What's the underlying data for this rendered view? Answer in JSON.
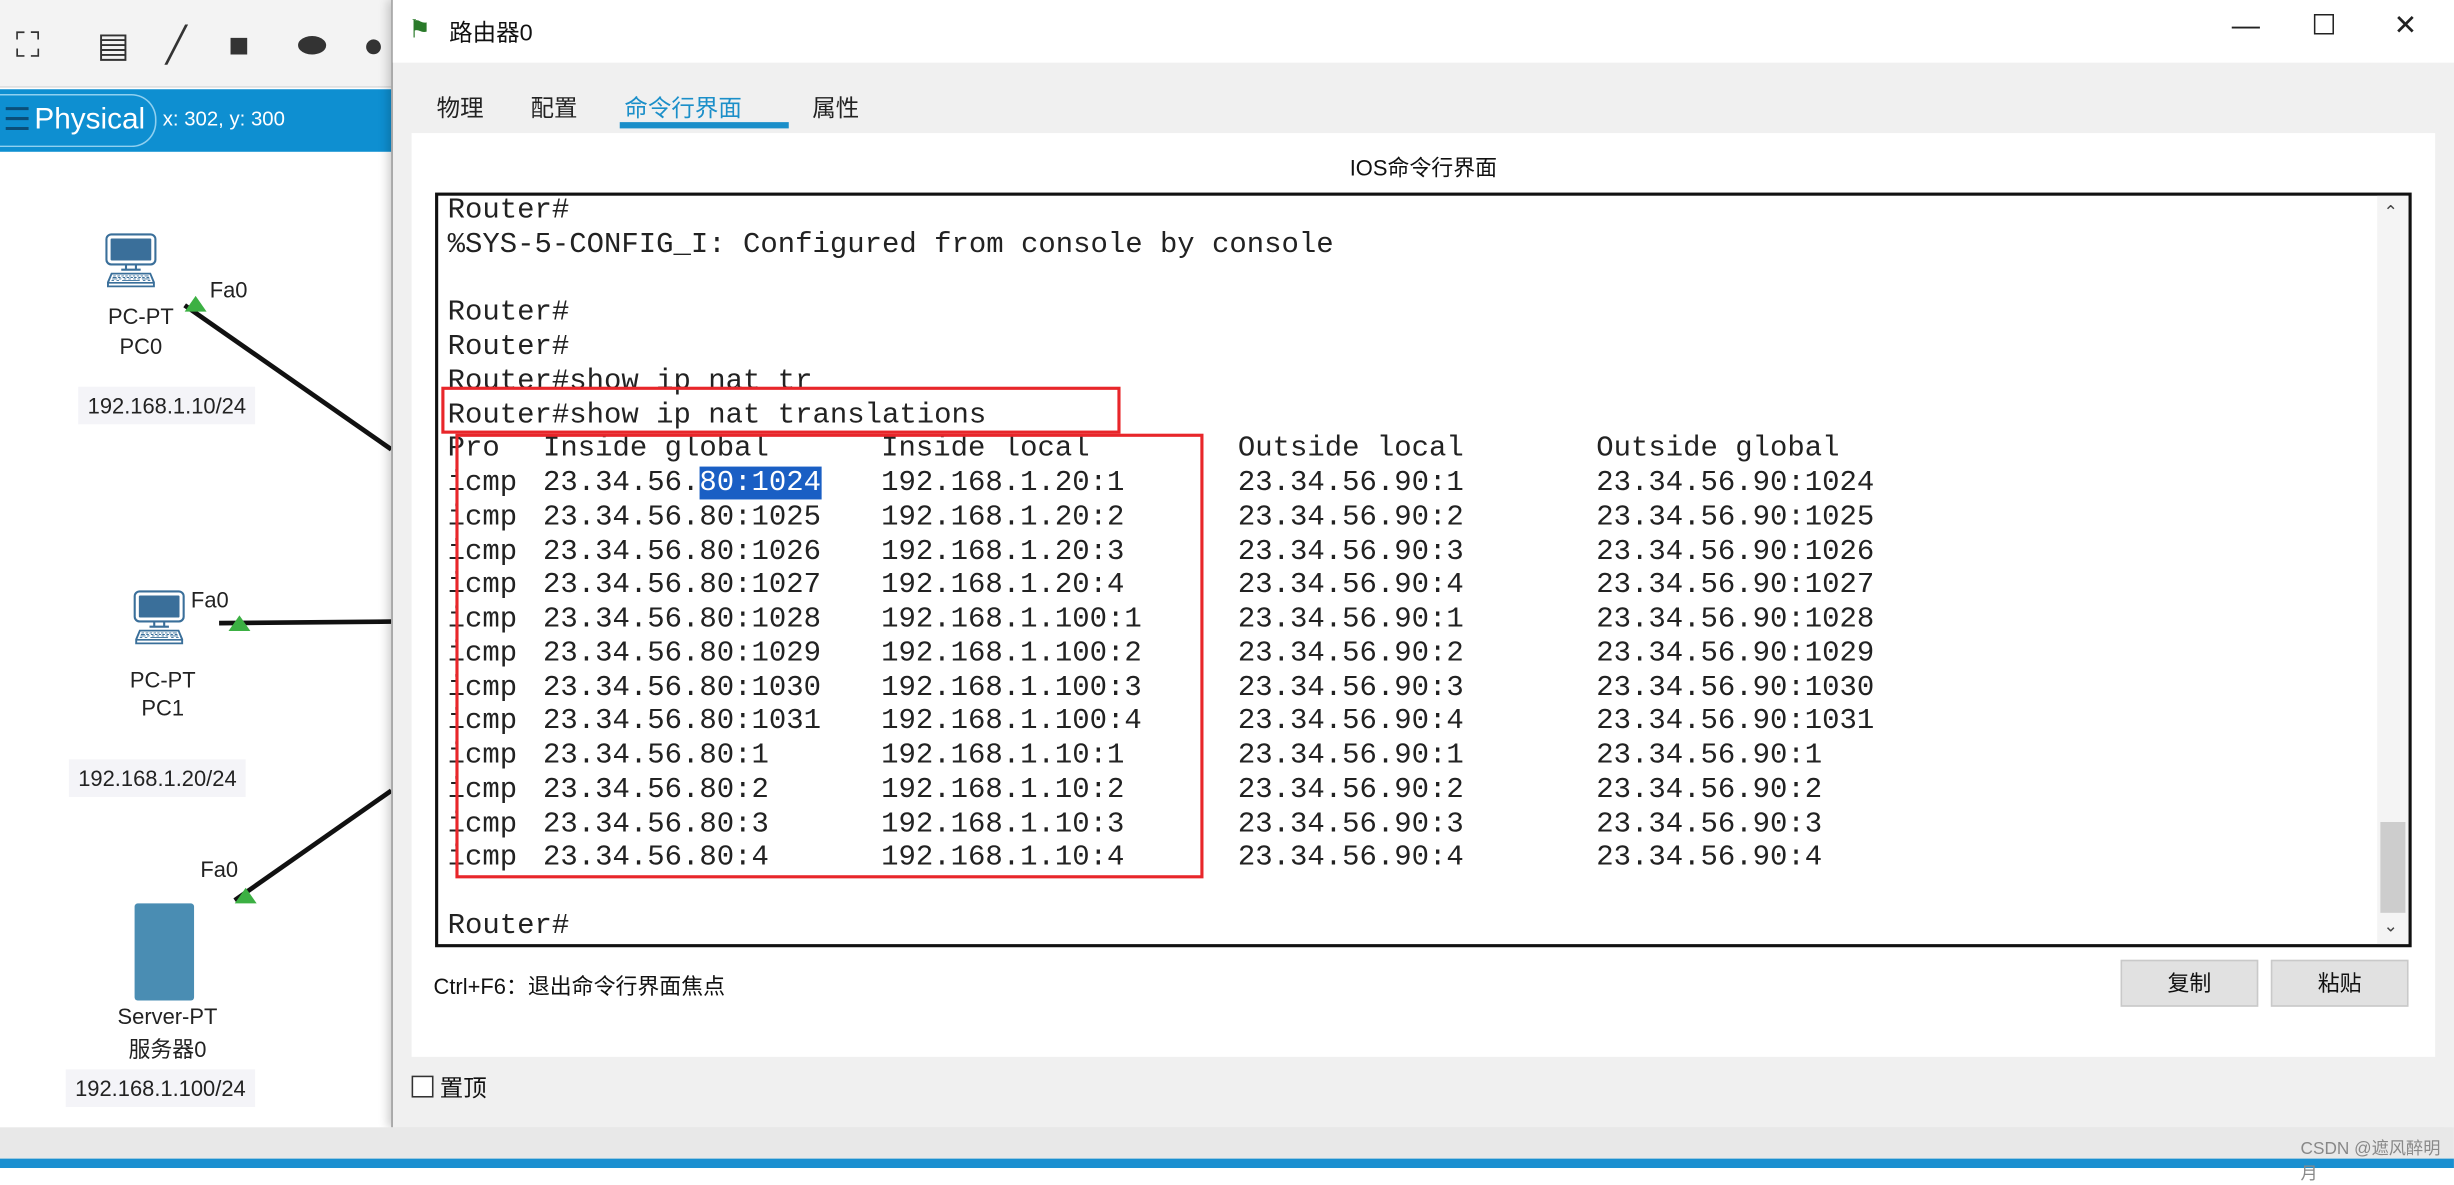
{
  "workspace": {
    "mode_label": "Physical",
    "coords": "x: 302, y: 300",
    "devices": [
      {
        "type": "PC-PT",
        "name": "PC0",
        "port": "Fa0",
        "ip": "192.168.1.10/24"
      },
      {
        "type": "PC-PT",
        "name": "PC1",
        "port": "Fa0",
        "ip": "192.168.1.20/24"
      },
      {
        "type": "Server-PT",
        "name": "服务器0",
        "port": "Fa0",
        "ip": "192.168.1.100/24"
      }
    ]
  },
  "window": {
    "title": "路由器0",
    "tabs": [
      {
        "label": "物理",
        "active": false
      },
      {
        "label": "配置",
        "active": false
      },
      {
        "label": "命令行界面",
        "active": true
      },
      {
        "label": "属性",
        "active": false
      }
    ],
    "panel_title": "IOS命令行界面",
    "accent_color": "#1b8fc9",
    "terminal": {
      "pre_lines": [
        "Router#",
        "%SYS-5-CONFIG_I: Configured from console by console",
        "",
        "Router#",
        "Router#",
        "Router#show ip nat tr",
        "Router#show ip nat translations"
      ],
      "headers": [
        "Pro",
        "Inside global",
        "Inside local",
        "Outside local",
        "Outside global"
      ],
      "rows": [
        [
          "icmp",
          "23.34.56.80:1024",
          "192.168.1.20:1",
          "23.34.56.90:1",
          "23.34.56.90:1024"
        ],
        [
          "icmp",
          "23.34.56.80:1025",
          "192.168.1.20:2",
          "23.34.56.90:2",
          "23.34.56.90:1025"
        ],
        [
          "icmp",
          "23.34.56.80:1026",
          "192.168.1.20:3",
          "23.34.56.90:3",
          "23.34.56.90:1026"
        ],
        [
          "icmp",
          "23.34.56.80:1027",
          "192.168.1.20:4",
          "23.34.56.90:4",
          "23.34.56.90:1027"
        ],
        [
          "icmp",
          "23.34.56.80:1028",
          "192.168.1.100:1",
          "23.34.56.90:1",
          "23.34.56.90:1028"
        ],
        [
          "icmp",
          "23.34.56.80:1029",
          "192.168.1.100:2",
          "23.34.56.90:2",
          "23.34.56.90:1029"
        ],
        [
          "icmp",
          "23.34.56.80:1030",
          "192.168.1.100:3",
          "23.34.56.90:3",
          "23.34.56.90:1030"
        ],
        [
          "icmp",
          "23.34.56.80:1031",
          "192.168.1.100:4",
          "23.34.56.90:4",
          "23.34.56.90:1031"
        ],
        [
          "icmp",
          "23.34.56.80:1",
          "192.168.1.10:1",
          "23.34.56.90:1",
          "23.34.56.90:1"
        ],
        [
          "icmp",
          "23.34.56.80:2",
          "192.168.1.10:2",
          "23.34.56.90:2",
          "23.34.56.90:2"
        ],
        [
          "icmp",
          "23.34.56.80:3",
          "192.168.1.10:3",
          "23.34.56.90:3",
          "23.34.56.90:3"
        ],
        [
          "icmp",
          "23.34.56.80:4",
          "192.168.1.10:4",
          "23.34.56.90:4",
          "23.34.56.90:4"
        ]
      ],
      "selection": "80:1024",
      "selection_prefix": "23.34.56.",
      "prompt": "Router#",
      "annotation_color": "#e8262a"
    },
    "hint": "Ctrl+F6：退出命令行界面焦点",
    "copy_label": "复制",
    "paste_label": "粘贴",
    "pin_label": "置顶",
    "pin_checked": false
  },
  "watermark": "CSDN @遮风醉明月"
}
